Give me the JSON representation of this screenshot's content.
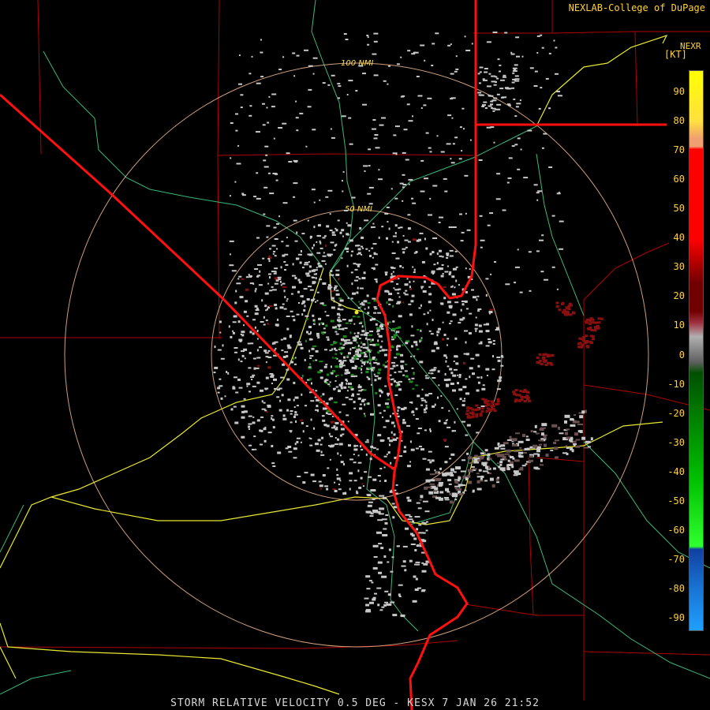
{
  "header": {
    "credit": "NEXLAB-College of DuPage",
    "product_code": "NEXR",
    "unit": "[KT]"
  },
  "caption": "STORM RELATIVE VELOCITY 0.5 DEG - KESX 7 JAN 26 21:52",
  "range_rings": {
    "inner_label": "50 NMI",
    "outer_label": "100 NMI"
  },
  "legend": {
    "ticks": [
      "90",
      "80",
      "70",
      "60",
      "50",
      "40",
      "30",
      "20",
      "10",
      "0",
      "-10",
      "-20",
      "-30",
      "-40",
      "-50",
      "-60",
      "-70",
      "-80",
      "-90"
    ],
    "colors": {
      "top": "#ffff00",
      "peach": "#f0a070",
      "red": "#ff0000",
      "dark_red": "#700000",
      "mid_red": "#a03040",
      "gray": "#b0b0b0",
      "dark_green": "#005000",
      "green": "#00c000",
      "bright_green": "#30ff30",
      "dark_blue": "#1040a0",
      "blue": "#2090ff",
      "cyan_blue": "#20a0ff"
    }
  },
  "map_colors": {
    "state_border": "#ff1010",
    "county_line": "#b00000",
    "highway": "#e8e830",
    "road": "#3cb878",
    "range_ring": "#f0b890",
    "echo_gray": "#c8c8c8",
    "echo_green": "#1a8a1a",
    "echo_red": "#8a1010"
  }
}
